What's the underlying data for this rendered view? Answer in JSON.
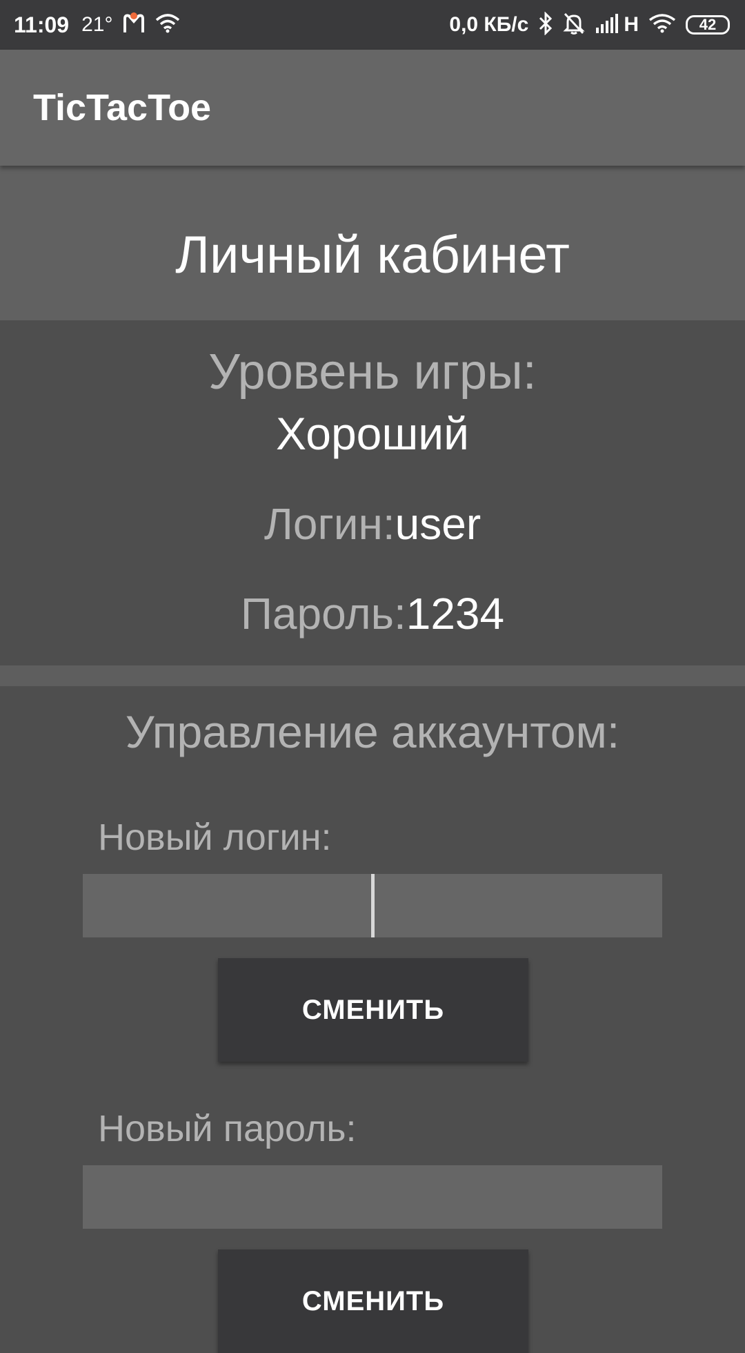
{
  "status_bar": {
    "time": "11:09",
    "temperature": "21°",
    "net_speed": "0,0 КБ/с",
    "network_type": "H",
    "battery": "42",
    "icons": [
      "notification-app-icon",
      "wifi-icon",
      "bluetooth-icon",
      "bell-muted-icon",
      "signal-icon",
      "wifi-icon"
    ]
  },
  "app_bar": {
    "title": "TicTacToe"
  },
  "header": {
    "title": "Личный кабинет"
  },
  "profile": {
    "level_label": "Уровень игры:",
    "level_value": "Хороший",
    "login_label": "Логин:",
    "login_value": "user",
    "password_label": "Пароль:",
    "password_value": "1234"
  },
  "account": {
    "title": "Управление аккаунтом:",
    "new_login_label": "Новый логин:",
    "new_login_value": "",
    "change_login_button": "СМЕНИТЬ",
    "new_password_label": "Новый пароль:",
    "new_password_value": "",
    "change_password_button": "СМЕНИТЬ"
  },
  "colors": {
    "status_bar_bg": "#3a3a3c",
    "app_bar_bg": "#666666",
    "header_bg": "#616161",
    "content_bg": "#4e4e4e",
    "input_bg": "#666666",
    "button_bg": "#38383a",
    "label_text": "#b3b3b3",
    "value_text": "#ffffff",
    "notification_accent": "#ef6a3a"
  }
}
